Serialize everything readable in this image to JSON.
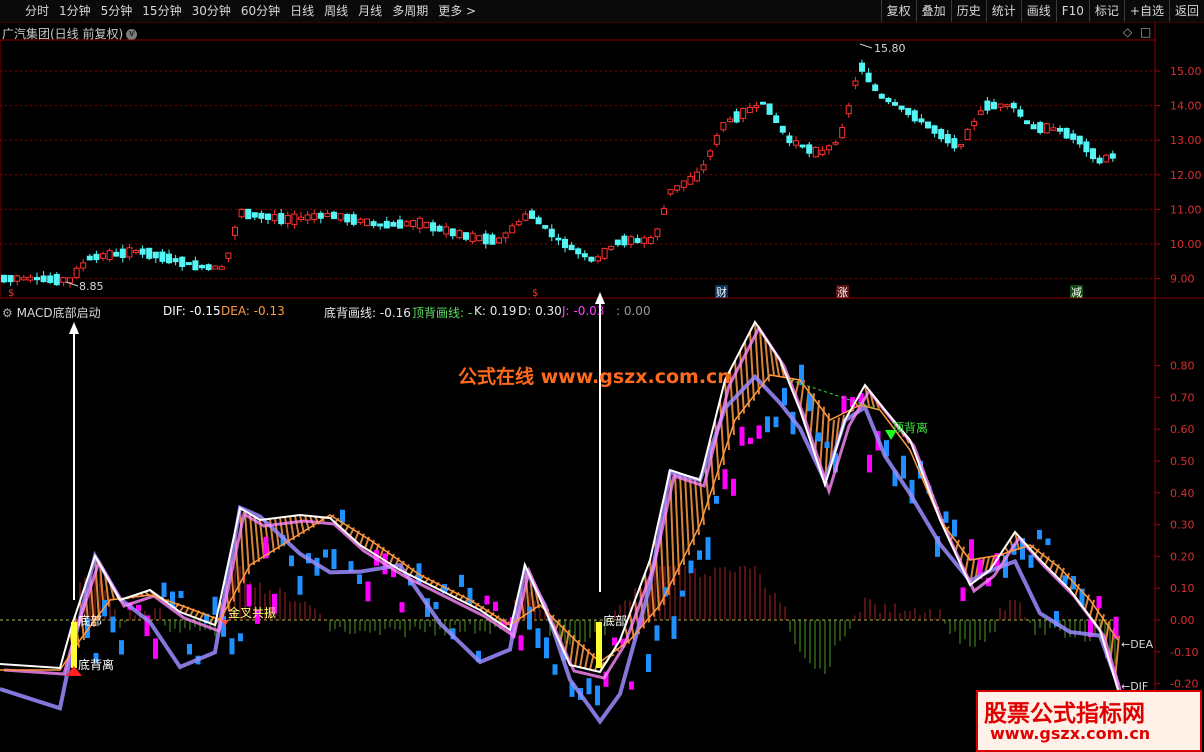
{
  "toolbar": {
    "periods": [
      "分时",
      "1分钟",
      "5分钟",
      "15分钟",
      "30分钟",
      "60分钟",
      "日线",
      "周线",
      "月线",
      "多周期",
      "更多 >"
    ],
    "tools": [
      "复权",
      "叠加",
      "历史",
      "统计",
      "画线",
      "F10",
      "标记",
      "+自选",
      "返回"
    ]
  },
  "price_panel": {
    "title": "广汽集团(日线 前复权)",
    "high_label": "15.80",
    "low_label": "8.85",
    "y_ticks": [
      "15.00",
      "14.00",
      "13.00",
      "12.00",
      "11.00",
      "10.00",
      "9.00"
    ],
    "markers": [
      "财",
      "涨",
      "减"
    ]
  },
  "indicator_panel": {
    "title": "MACD底部启动",
    "dif": "DIF: -0.15",
    "dea": "DEA: -0.13",
    "bottom_line": "底背画线: -0.16",
    "top_line": "顶背画线: -",
    "k": "K: 0.19",
    "d": "D: 0.30",
    "j": "J: -0.03",
    "extra": ": 0.00",
    "y_ticks": [
      "0.80",
      "0.70",
      "0.60",
      "0.50",
      "0.40",
      "0.30",
      "0.20",
      "0.10",
      "0.00",
      "-0.10",
      "-0.20"
    ],
    "annotations": {
      "bottom1": "底部",
      "divergence1": "底背离",
      "golden_cross": "金叉共振",
      "bottom2": "底部",
      "top_divergence": "顶背离",
      "dea_label": "←DEA",
      "dif_label": "←DIF"
    }
  },
  "watermarks": {
    "site": "公式在线 www.gszx.com.cn",
    "brand": "股票公式指标网",
    "brand_url": "www.gszx.com.cn"
  },
  "colors": {
    "up": "#ff3030",
    "down": "#54f5f5",
    "up_fill": "#000000",
    "dif_line": "#ffffff",
    "dea_line": "#ff9a40",
    "pink": "#ff88ff",
    "blue_bar": "#1e90ff",
    "magenta_bar": "#ff00ff",
    "green_hist": "#5fbf2f",
    "grid": "#8b0000"
  }
}
